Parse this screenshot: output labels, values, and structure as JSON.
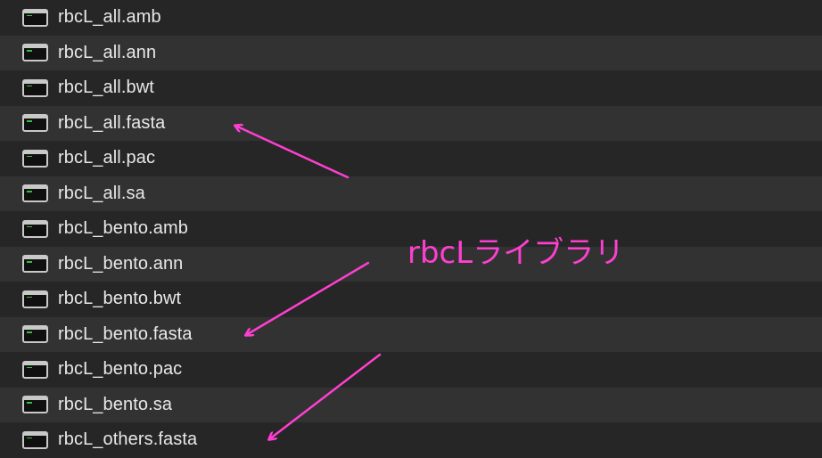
{
  "files": [
    {
      "name": "rbcL_all.amb",
      "icon": "terminal-file-icon"
    },
    {
      "name": "rbcL_all.ann",
      "icon": "terminal-file-icon"
    },
    {
      "name": "rbcL_all.bwt",
      "icon": "terminal-file-icon"
    },
    {
      "name": "rbcL_all.fasta",
      "icon": "terminal-file-icon"
    },
    {
      "name": "rbcL_all.pac",
      "icon": "terminal-file-icon"
    },
    {
      "name": "rbcL_all.sa",
      "icon": "terminal-file-icon"
    },
    {
      "name": "rbcL_bento.amb",
      "icon": "terminal-file-icon"
    },
    {
      "name": "rbcL_bento.ann",
      "icon": "terminal-file-icon"
    },
    {
      "name": "rbcL_bento.bwt",
      "icon": "terminal-file-icon"
    },
    {
      "name": "rbcL_bento.fasta",
      "icon": "terminal-file-icon"
    },
    {
      "name": "rbcL_bento.pac",
      "icon": "terminal-file-icon"
    },
    {
      "name": "rbcL_bento.sa",
      "icon": "terminal-file-icon"
    },
    {
      "name": "rbcL_others.fasta",
      "icon": "terminal-file-icon"
    }
  ],
  "annotation": {
    "label": "rbcLライブラリ",
    "color": "#ff3fd0"
  },
  "colors": {
    "row_dark": "#262626",
    "row_light": "#323232",
    "text": "#e8e8e8"
  }
}
